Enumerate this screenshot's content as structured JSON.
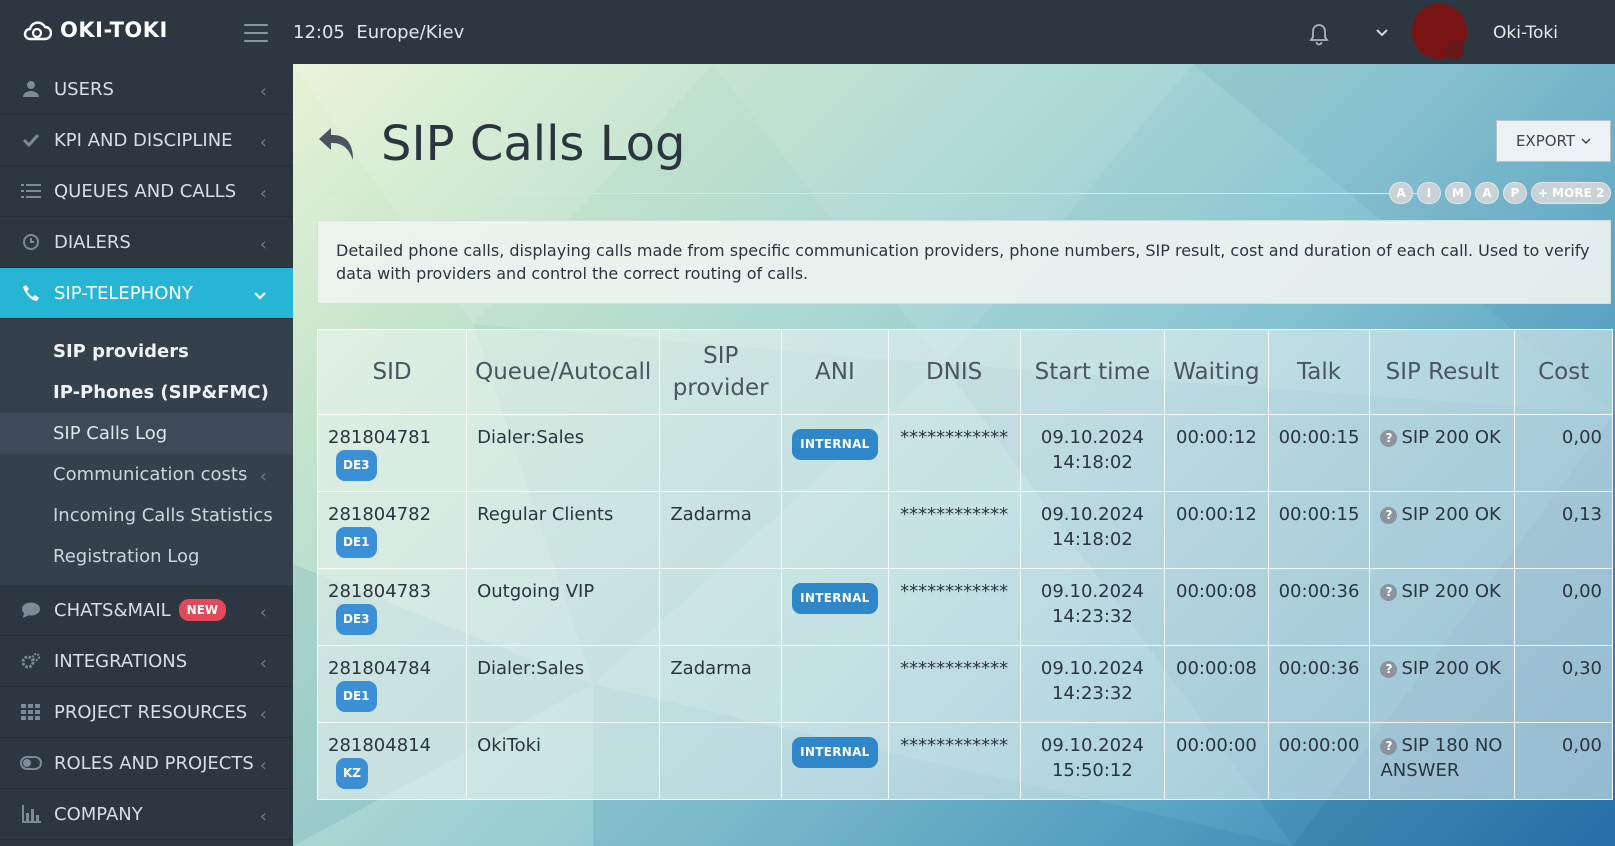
{
  "app": {
    "logo_text": "OKI-TOKI",
    "time": "12:05",
    "timezone": "Europe/Kiev",
    "user_name": "Oki-Toki"
  },
  "sidebar": {
    "items": [
      {
        "label": "USERS",
        "icon": "user-icon"
      },
      {
        "label": "KPI AND DISCIPLINE",
        "icon": "check-icon"
      },
      {
        "label": "QUEUES AND CALLS",
        "icon": "list-icon"
      },
      {
        "label": "DIALERS",
        "icon": "clock-icon"
      },
      {
        "label": "SIP-TELEPHONY",
        "icon": "phone-icon",
        "active": true
      }
    ],
    "submenu": [
      {
        "label": "SIP providers"
      },
      {
        "label": "IP-Phones (SIP&FMC)"
      },
      {
        "label": "SIP Calls Log",
        "current": true
      },
      {
        "label": "Communication costs"
      },
      {
        "label": "Incoming Calls Statistics"
      },
      {
        "label": "Registration Log"
      }
    ],
    "items_after": [
      {
        "label": "CHATS&MAIL",
        "icon": "chat-icon",
        "badge": "NEW"
      },
      {
        "label": "INTEGRATIONS",
        "icon": "gears-icon"
      },
      {
        "label": "PROJECT RESOURCES",
        "icon": "grid-icon"
      },
      {
        "label": "ROLES AND PROJECTS",
        "icon": "toggle-icon"
      },
      {
        "label": "COMPANY",
        "icon": "bar-chart-icon"
      }
    ]
  },
  "main": {
    "title": "SIP Calls Log",
    "export_label": "EXPORT",
    "tags": [
      "A",
      "I",
      "M",
      "A",
      "P",
      "+ MORE 2"
    ],
    "description": "Detailed phone calls, displaying calls made from specific communication providers, phone numbers, SIP result, cost and duration of each call. Used to verify data with providers and control the correct routing of calls.",
    "table": {
      "headers": [
        "SID",
        "Queue/Autocall",
        "SIP provider",
        "ANI",
        "DNIS",
        "Start time",
        "Waiting",
        "Talk",
        "SIP Result",
        "Cost"
      ],
      "rows": [
        {
          "sid": "281804781",
          "sid_badge": "DE3",
          "queue": "Dialer:Sales",
          "provider": "",
          "ani": "INTERNAL",
          "dnis": "************",
          "start_date": "09.10.2024",
          "start_time": "14:18:02",
          "waiting": "00:00:12",
          "talk": "00:00:15",
          "result": "SIP 200 OK",
          "cost": "0,00"
        },
        {
          "sid": "281804782",
          "sid_badge": "DE1",
          "queue": "Regular Clients",
          "provider": "Zadarma",
          "ani": "",
          "dnis": "************",
          "start_date": "09.10.2024",
          "start_time": "14:18:02",
          "waiting": "00:00:12",
          "talk": "00:00:15",
          "result": "SIP 200 OK",
          "cost": "0,13"
        },
        {
          "sid": "281804783",
          "sid_badge": "DE3",
          "queue": "Outgoing VIP",
          "provider": "",
          "ani": "INTERNAL",
          "dnis": "************",
          "start_date": "09.10.2024",
          "start_time": "14:23:32",
          "waiting": "00:00:08",
          "talk": "00:00:36",
          "result": "SIP 200 OK",
          "cost": "0,00"
        },
        {
          "sid": "281804784",
          "sid_badge": "DE1",
          "queue": "Dialer:Sales",
          "provider": "Zadarma",
          "ani": "",
          "dnis": "************",
          "start_date": "09.10.2024",
          "start_time": "14:23:32",
          "waiting": "00:00:08",
          "talk": "00:00:36",
          "result": "SIP 200 OK",
          "cost": "0,30"
        },
        {
          "sid": "281804814",
          "sid_badge": "KZ",
          "queue": "OkiToki",
          "provider": "",
          "ani": "INTERNAL",
          "dnis": "************",
          "start_date": "09.10.2024",
          "start_time": "15:50:12",
          "waiting": "00:00:00",
          "talk": "00:00:00",
          "result": "SIP 180 NO ANSWER",
          "cost": "0,00"
        }
      ]
    }
  }
}
